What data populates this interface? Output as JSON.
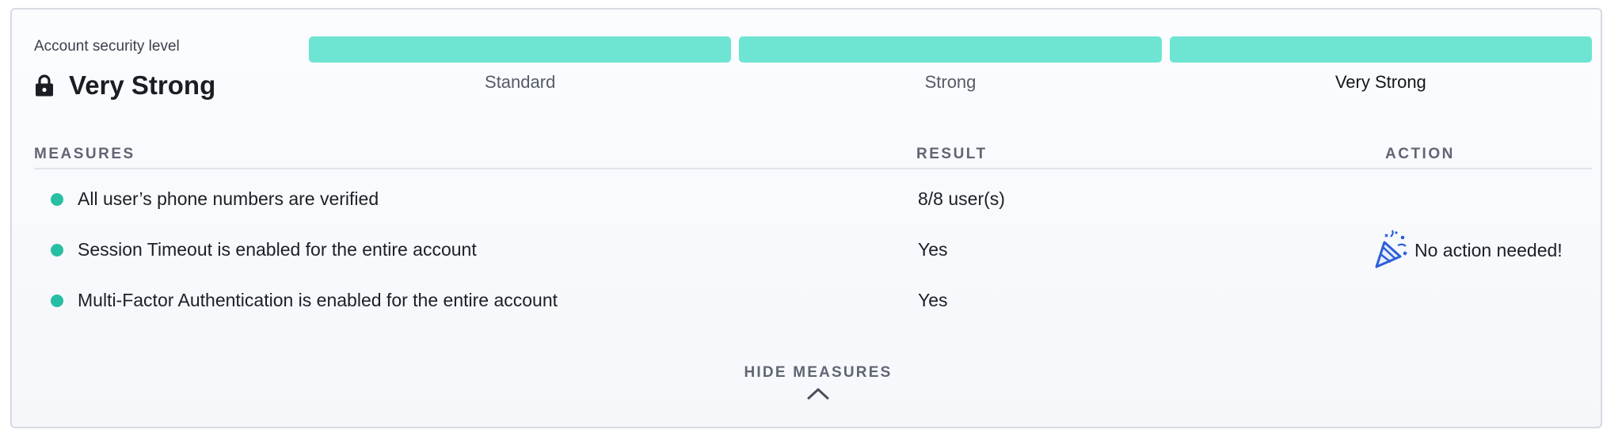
{
  "security": {
    "caption": "Account security level",
    "level": "Very Strong",
    "meter_levels": [
      {
        "label": "Standard",
        "filled": true,
        "active": false
      },
      {
        "label": "Strong",
        "filled": true,
        "active": false
      },
      {
        "label": "Very Strong",
        "filled": true,
        "active": true
      }
    ],
    "meter_color": "#6ee4d3"
  },
  "table": {
    "headers": {
      "measures": "MEASURES",
      "result": "RESULT",
      "action": "ACTION"
    },
    "rows": [
      {
        "measure": "All user’s phone numbers are verified",
        "result": "8/8 user(s)",
        "status_color": "#27bfa3"
      },
      {
        "measure": "Session Timeout is enabled for the entire account",
        "result": "Yes",
        "status_color": "#27bfa3"
      },
      {
        "measure": "Multi-Factor Authentication is enabled for the entire account",
        "result": "Yes",
        "status_color": "#27bfa3"
      }
    ],
    "action": {
      "icon": "party-popper-icon",
      "text": "No action needed!"
    }
  },
  "toggle": {
    "label": "HIDE MEASURES",
    "icon": "chevron-up-icon"
  }
}
